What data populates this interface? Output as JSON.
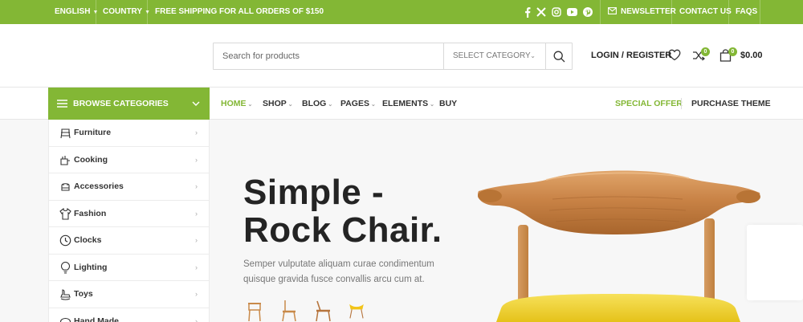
{
  "topbar": {
    "language": "ENGLISH",
    "country": "COUNTRY",
    "shipping": "FREE SHIPPING FOR ALL ORDERS OF $150",
    "newsletter": "NEWSLETTER",
    "contact": "CONTACT US",
    "faqs": "FAQS",
    "social_icons": [
      "facebook-icon",
      "x-icon",
      "instagram-icon",
      "youtube-icon",
      "pinterest-icon"
    ],
    "bg_color": "#83b735"
  },
  "header": {
    "search_placeholder": "Search for products",
    "category_select": "SELECT CATEGORY",
    "login": "LOGIN / REGISTER",
    "compare_count": "0",
    "cart_count": "0",
    "cart_total": "$0.00"
  },
  "nav": {
    "browse_label": "BROWSE CATEGORIES",
    "items": [
      {
        "label": "HOME",
        "dropdown": true,
        "active": true
      },
      {
        "label": "SHOP",
        "dropdown": true,
        "active": false
      },
      {
        "label": "BLOG",
        "dropdown": true,
        "active": false
      },
      {
        "label": "PAGES",
        "dropdown": true,
        "active": false
      },
      {
        "label": "ELEMENTS",
        "dropdown": true,
        "active": false
      },
      {
        "label": "BUY",
        "dropdown": false,
        "active": false
      }
    ],
    "special_offer": "SPECIAL OFFER",
    "purchase_theme": "PURCHASE THEME",
    "accent_color": "#83b735"
  },
  "sidebar": {
    "items": [
      {
        "label": "Furniture",
        "icon": "furniture-icon"
      },
      {
        "label": "Cooking",
        "icon": "cooking-icon"
      },
      {
        "label": "Accessories",
        "icon": "accessories-icon"
      },
      {
        "label": "Fashion",
        "icon": "fashion-icon"
      },
      {
        "label": "Clocks",
        "icon": "clock-icon"
      },
      {
        "label": "Lighting",
        "icon": "lighting-icon"
      },
      {
        "label": "Toys",
        "icon": "toys-icon"
      },
      {
        "label": "Hand Made",
        "icon": "hand-made-icon"
      }
    ]
  },
  "hero": {
    "title_line1": "Simple -",
    "title_line2": "Rock Chair.",
    "description": "Semper vulputate aliquam curae condimentum quisque gravida fusce convallis arcu cum at."
  }
}
